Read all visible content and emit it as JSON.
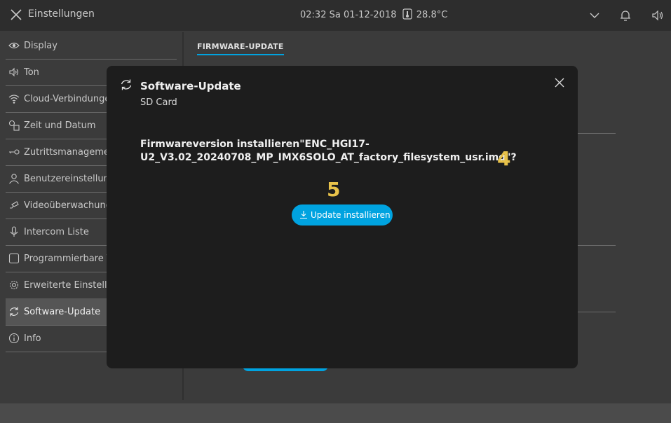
{
  "topbar": {
    "title": "Einstellungen",
    "datetime": "02:32  Sa 01-12-2018",
    "temperature": "28.8°C"
  },
  "sidebar": {
    "items": [
      {
        "label": "Display",
        "icon": "eye-icon"
      },
      {
        "label": "Ton",
        "icon": "speaker-icon"
      },
      {
        "label": "Cloud-Verbindungen",
        "icon": "wifi-icon"
      },
      {
        "label": "Zeit und Datum",
        "icon": "clock-calendar-icon"
      },
      {
        "label": "Zutrittsmanagement",
        "icon": "key-icon"
      },
      {
        "label": "Benutzereinstellungen",
        "icon": "user-icon"
      },
      {
        "label": "Videoüberwachung",
        "icon": "camera-icon"
      },
      {
        "label": "Intercom Liste",
        "icon": "microphone-icon"
      },
      {
        "label": "Programmierbare Tasten",
        "icon": "square-icon"
      },
      {
        "label": "Erweiterte Einstellungen",
        "icon": "gear-icon"
      },
      {
        "label": "Software-Update",
        "icon": "refresh-icon"
      },
      {
        "label": "Info",
        "icon": "info-icon"
      }
    ],
    "active_index": 10
  },
  "main": {
    "tab_label": "FIRMWARE-UPDATE"
  },
  "modal": {
    "title": "Software-Update",
    "subtitle": "SD Card",
    "message_line1": "Firmwareversion installieren\"ENC_HGI17-",
    "message_line2": "U2_V3.02_20240708_MP_IMX6SOLO_AT_factory_filesystem_usr.img\"?",
    "install_button_label": "Update installieren"
  },
  "callouts": {
    "c4": "4",
    "c5": "5"
  },
  "colors": {
    "accent": "#00a3e0",
    "callout": "#e8c24a",
    "modal_bg": "#1d1d1d",
    "topbar_bg": "#2d2d2d"
  }
}
